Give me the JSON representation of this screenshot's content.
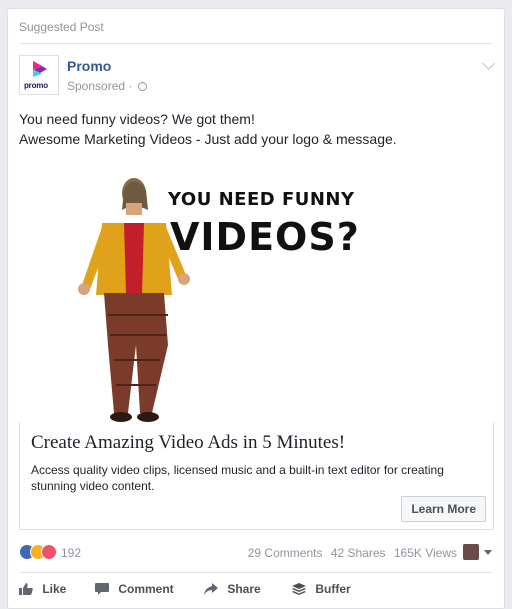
{
  "suggested_label": "Suggested Post",
  "page": {
    "name": "Promo",
    "sponsored": "Sponsored ·",
    "logo_text": "promo"
  },
  "post_text": {
    "line1": "You need funny videos? We got them!",
    "line2": "Awesome Marketing Videos - Just add your logo & message."
  },
  "media": {
    "caption1": "YOU NEED FUNNY",
    "caption2": "VIDEOS?"
  },
  "link": {
    "title": "Create Amazing Video Ads in 5 Minutes!",
    "description": "Access quality video clips, licensed music and a built-in text editor for creating stunning video content.",
    "cta": "Learn More"
  },
  "stats": {
    "reactions": "192",
    "comments": "29 Comments",
    "shares": "42 Shares",
    "views": "165K Views"
  },
  "actions": {
    "like": "Like",
    "comment": "Comment",
    "share": "Share",
    "buffer": "Buffer"
  },
  "colors": {
    "brand_link": "#365899",
    "reaction_like": "#4267b2",
    "reaction_haha": "#f7b125",
    "reaction_love": "#f25268"
  }
}
